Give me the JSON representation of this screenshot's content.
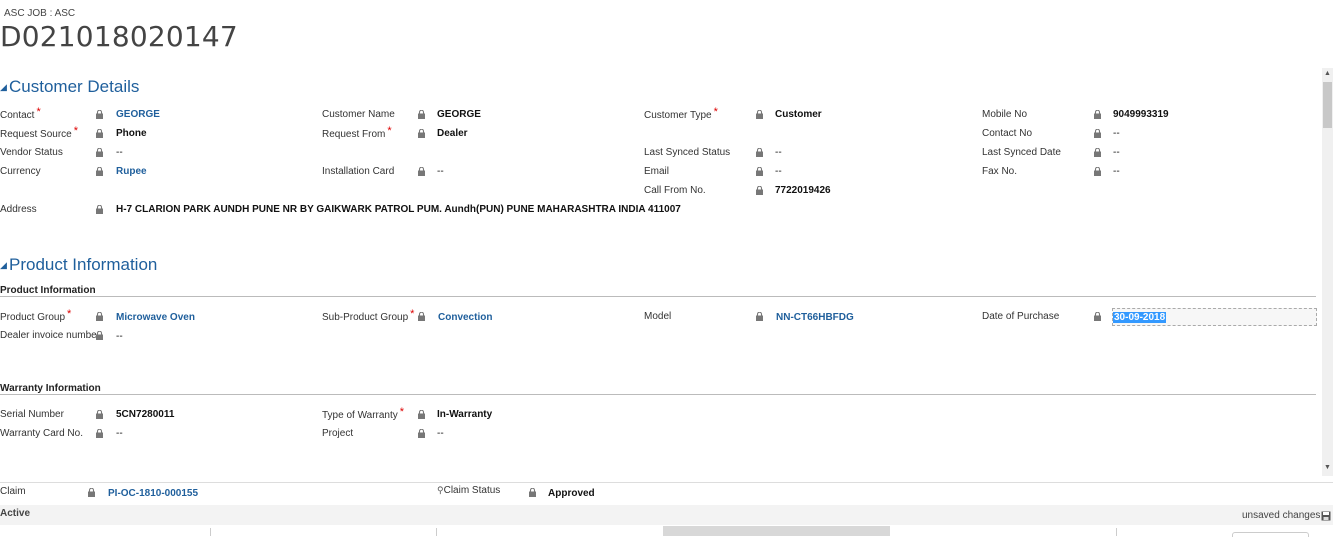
{
  "header": {
    "entity_type": "ASC JOB : ASC",
    "record_id": "D021018020147"
  },
  "customer_details": {
    "title": "Customer Details",
    "contact_label": "Contact",
    "contact_value": "GEORGE",
    "customer_name_label": "Customer Name",
    "customer_name_value": "GEORGE",
    "customer_type_label": "Customer Type",
    "customer_type_value": "Customer",
    "mobile_no_label": "Mobile No",
    "mobile_no_value": "9049993319",
    "request_source_label": "Request Source",
    "request_source_value": "Phone",
    "request_from_label": "Request From",
    "request_from_value": "Dealer",
    "contact_no_label": "Contact No",
    "contact_no_value": "--",
    "vendor_status_label": "Vendor Status",
    "vendor_status_value": "--",
    "last_synced_status_label": "Last Synced Status",
    "last_synced_status_value": "--",
    "last_synced_date_label": "Last Synced Date",
    "last_synced_date_value": "--",
    "currency_label": "Currency",
    "currency_value": "Rupee",
    "installation_card_label": "Installation Card",
    "installation_card_value": "--",
    "email_label": "Email",
    "email_value": "--",
    "fax_label": "Fax No.",
    "fax_value": "--",
    "call_from_label": "Call From No.",
    "call_from_value": "7722019426",
    "address_label": "Address",
    "address_value": "H-7 CLARION PARK AUNDH PUNE NR BY GAIKWARK PATROL PUM. Aundh(PUN) PUNE MAHARASHTRA INDIA 411007"
  },
  "product_information": {
    "title": "Product Information",
    "subheader": "Product Information",
    "product_group_label": "Product Group",
    "product_group_value": "Microwave Oven",
    "sub_product_group_label": "Sub-Product Group",
    "sub_product_group_value": "Convection",
    "model_label": "Model",
    "model_value": "NN-CT66HBFDG",
    "date_of_purchase_label": "Date of Purchase",
    "date_of_purchase_value": "30-09-2018",
    "dealer_invoice_label": "Dealer invoice numbe",
    "dealer_invoice_value": "--"
  },
  "warranty_information": {
    "subheader": "Warranty Information",
    "serial_number_label": "Serial Number",
    "serial_number_value": "5CN7280011",
    "type_of_warranty_label": "Type of Warranty",
    "type_of_warranty_value": "In-Warranty",
    "warranty_card_label": "Warranty Card No.",
    "warranty_card_value": "--",
    "project_label": "Project",
    "project_value": "--"
  },
  "footer": {
    "claim_label": "Claim",
    "claim_value": "PI-OC-1810-000155",
    "claim_status_label": "Claim Status",
    "claim_status_value": "Approved",
    "status": "Active",
    "unsaved": "unsaved changes"
  },
  "icons": [
    "lock-icon",
    "save-icon",
    "collapse-triangle-icon",
    "scroll-up-icon",
    "scroll-down-icon"
  ],
  "colors": {
    "accent": "#1f5f9c",
    "required": "#dd0000",
    "selection": "#3399ff"
  }
}
